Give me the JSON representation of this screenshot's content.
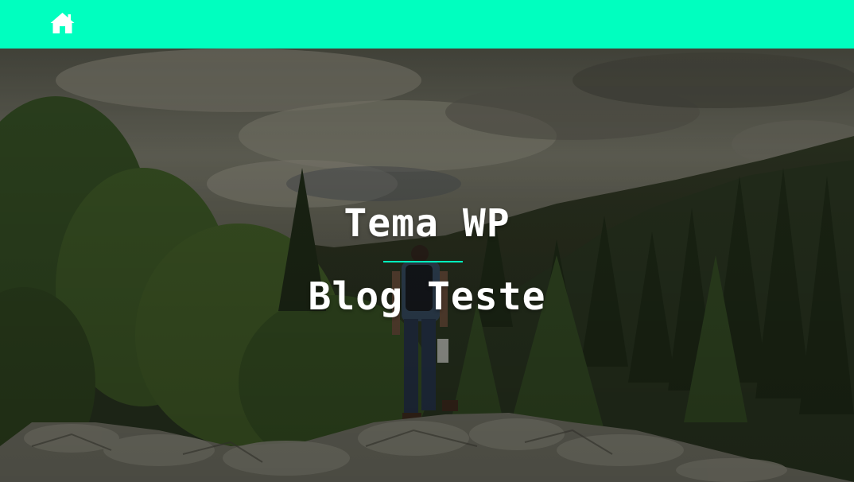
{
  "header": {
    "background_color": "#00ffbf",
    "home_icon": "home-icon"
  },
  "hero": {
    "title": "Tema WP",
    "subtitle": "Blog Teste",
    "divider_color": "#00ffbf",
    "image": "hiker-on-rocks-forest-mountains"
  }
}
